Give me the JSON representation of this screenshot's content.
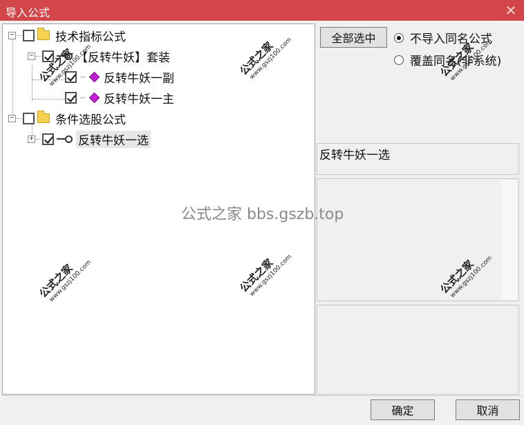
{
  "window": {
    "title": "导入公式",
    "close_glyph": "✕"
  },
  "tree": {
    "nodes": [
      {
        "label": "技术指标公式",
        "icon": "folder-icon",
        "expander": "−",
        "checked": false
      },
      {
        "label": "【反转牛妖】套装",
        "icon": "key-icon",
        "expander": "−",
        "checked": true
      },
      {
        "label": "反转牛妖一副",
        "icon": "gem-icon",
        "checked": true
      },
      {
        "label": "反转牛妖一主",
        "icon": "gem-icon",
        "checked": true
      },
      {
        "label": "条件选股公式",
        "icon": "folder-icon",
        "expander": "−",
        "checked": false
      },
      {
        "label": "反转牛妖一选",
        "icon": "key-icon",
        "expander": "+",
        "checked": true,
        "selected": true
      }
    ]
  },
  "options": {
    "select_all_label": "全部选中",
    "radio_skip_label": "不导入同名公式",
    "radio_overwrite_label": "覆盖同名(非系统)",
    "selected_option": "不导入同名公式"
  },
  "preview": {
    "name": "反转牛妖一选"
  },
  "footer": {
    "ok_label": "确定",
    "cancel_label": "取消"
  },
  "watermarks": {
    "stamp_text": "公式之家",
    "stamp_url": "www.gszj100.com",
    "center_text": "公式之家 bbs.gszb.top"
  },
  "colors": {
    "titlebar": "#d2464a",
    "gem": "#c41fd4",
    "folder": "#f6d253"
  }
}
